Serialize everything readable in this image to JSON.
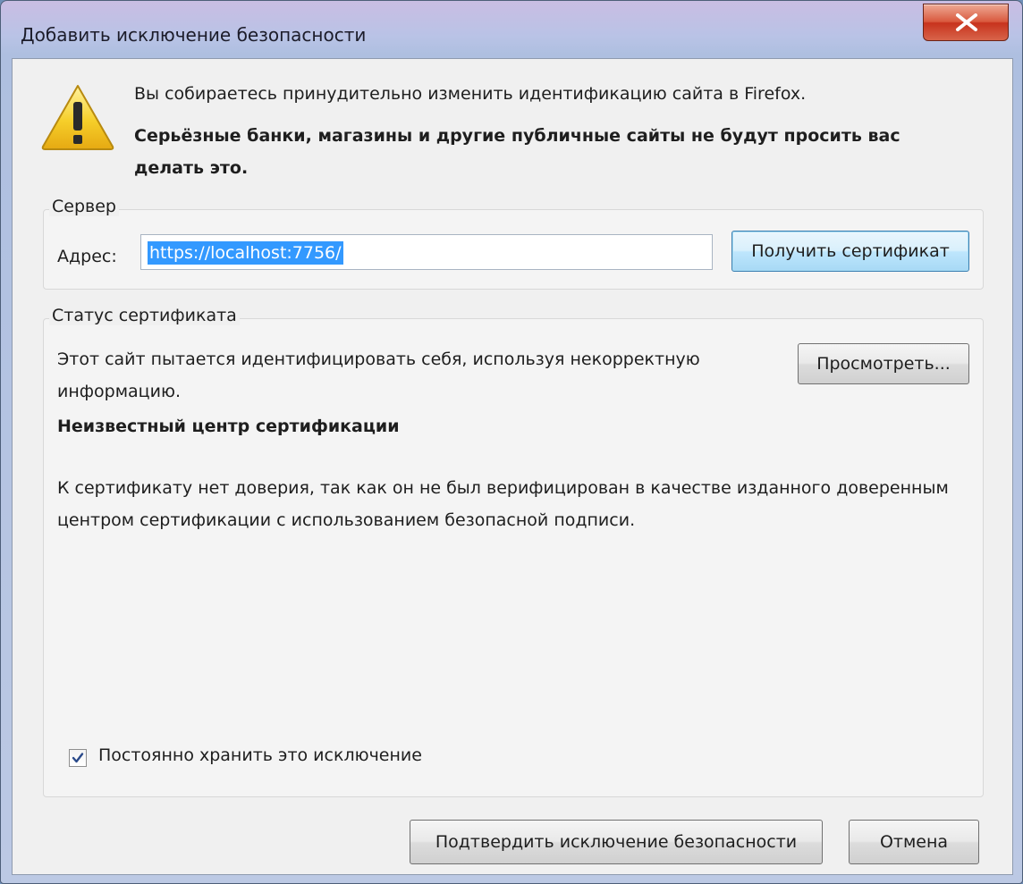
{
  "window": {
    "title": "Добавить исключение безопасности",
    "close_label": "X"
  },
  "intro": {
    "line1": "Вы собираетесь принудительно изменить идентификацию сайта в Firefox.",
    "line2": "Серьёзные банки, магазины и другие публичные сайты не будут просить вас делать это."
  },
  "server": {
    "group_label": "Сервер",
    "address_label": "Адрес:",
    "address_value": "https://localhost:7756/",
    "get_cert_button": "Получить сертификат"
  },
  "status": {
    "group_label": "Статус сертификата",
    "text": "Этот сайт пытается идентифицировать себя, используя некорректную информацию.",
    "view_button": "Просмотреть...",
    "title": "Неизвестный центр сертификации",
    "detail": "К сертификату нет доверия, так как он не был верифицирован в качестве изданного доверенным центром сертификации с использованием безопасной подписи."
  },
  "options": {
    "permanent_label": "Постоянно хранить это исключение",
    "permanent_checked": true
  },
  "actions": {
    "confirm_button": "Подтвердить исключение безопасности",
    "cancel_button": "Отмена"
  },
  "icons": {
    "warning": "warning-triangle-icon",
    "close": "close-icon",
    "check": "check-icon"
  },
  "colors": {
    "selection": "#3399ff",
    "close_button": "#c7331d",
    "warning_yellow": "#f6cf2a"
  }
}
